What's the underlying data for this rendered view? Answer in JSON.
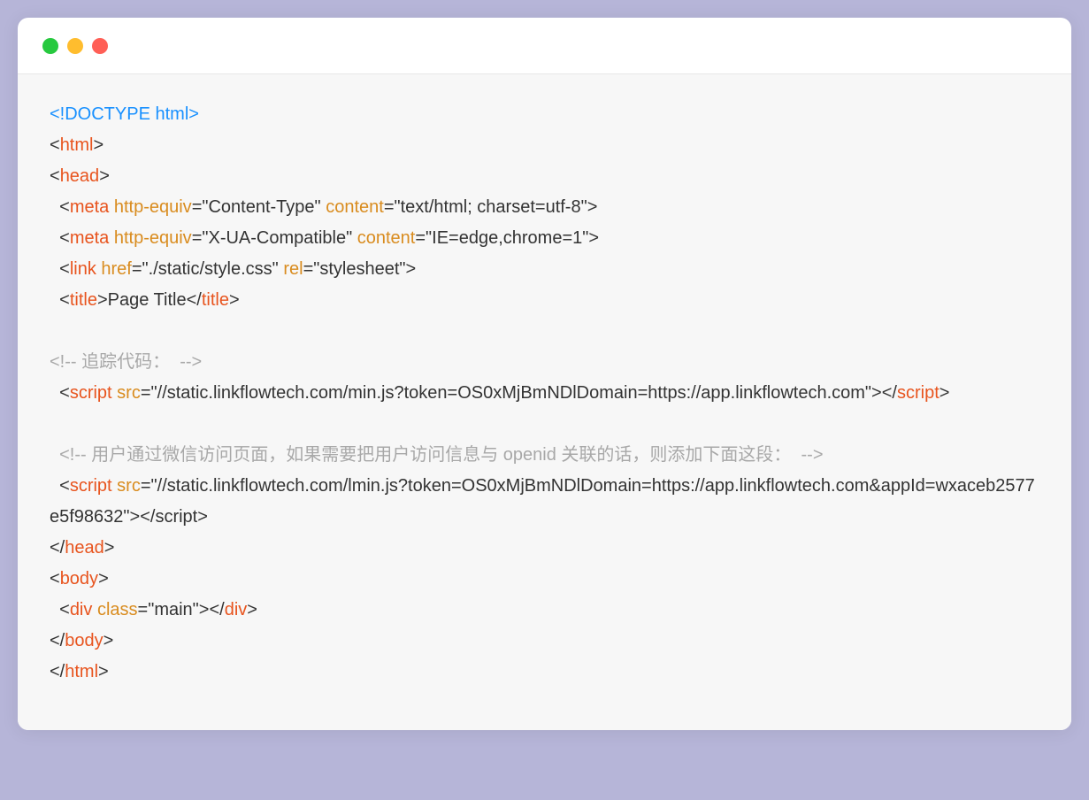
{
  "code": {
    "lines": [
      {
        "type": "doctype",
        "text": "<!DOCTYPE html>"
      },
      {
        "type": "tag-open",
        "tag": "html"
      },
      {
        "type": "tag-open",
        "tag": "head"
      },
      {
        "type": "tag-selfclose",
        "indent": "  ",
        "tag": "meta",
        "attrs": [
          {
            "name": "http-equiv",
            "value": "\"Content-Type\""
          },
          {
            "name": "content",
            "value": "\"text/html; charset=utf-8\""
          }
        ]
      },
      {
        "type": "tag-selfclose",
        "indent": "  ",
        "tag": "meta",
        "attrs": [
          {
            "name": "http-equiv",
            "value": "\"X-UA-Compatible\""
          },
          {
            "name": "content",
            "value": "\"IE=edge,chrome=1\""
          }
        ]
      },
      {
        "type": "tag-selfclose",
        "indent": "  ",
        "tag": "link",
        "attrs": [
          {
            "name": "href",
            "value": "\"./static/style.css\""
          },
          {
            "name": "rel",
            "value": "\"stylesheet\""
          }
        ]
      },
      {
        "type": "tag-wrap",
        "indent": "  ",
        "tag": "title",
        "inner": "Page Title"
      },
      {
        "type": "blank"
      },
      {
        "type": "comment",
        "text": "<!-- 追踪代码：  -->"
      },
      {
        "type": "script-line",
        "indent": "  ",
        "tag": "script",
        "attrs": [
          {
            "name": "src",
            "value": "\"//static.linkflowtech.com/min.js?token=OS0xMjBmNDlDomain=https://app.linkflowtech.com\""
          }
        ]
      },
      {
        "type": "blank"
      },
      {
        "type": "comment",
        "indent": "  ",
        "text": "<!-- 用户通过微信访问页面，如果需要把用户访问信息与 openid 关联的话，则添加下面这段：  -->"
      },
      {
        "type": "script-line-plain",
        "indent": "  ",
        "tag": "script",
        "attrs": [
          {
            "name": "src",
            "value": "\"//static.linkflowtech.com/lmin.js?token=OS0xMjBmNDlDomain=https://app.linkflowtech.com&appId=wxaceb2577e5f98632\""
          }
        ]
      },
      {
        "type": "tag-close",
        "tag": "head"
      },
      {
        "type": "tag-open",
        "tag": "body"
      },
      {
        "type": "tag-wrap",
        "indent": "  ",
        "tag": "div",
        "attrs": [
          {
            "name": "class",
            "value": "\"main\""
          }
        ],
        "inner": ""
      },
      {
        "type": "tag-close",
        "tag": "body"
      },
      {
        "type": "tag-close",
        "tag": "html"
      }
    ]
  }
}
